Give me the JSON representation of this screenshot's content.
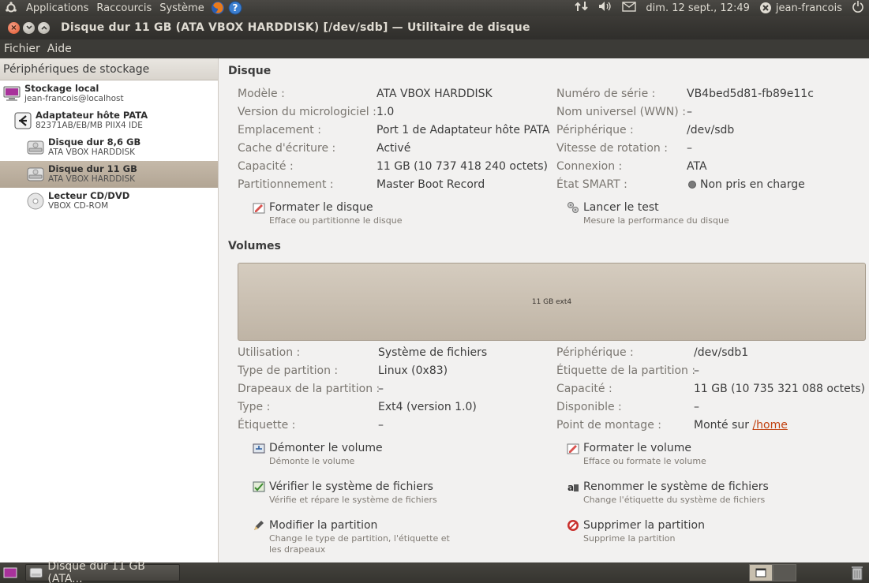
{
  "top_panel": {
    "menus": [
      "Applications",
      "Raccourcis",
      "Système"
    ],
    "clock": "dim. 12 sept., 12:49",
    "user": "jean-francois"
  },
  "window": {
    "title": "Disque dur 11 GB (ATA VBOX HARDDISK) [/dev/sdb] — Utilitaire de disque"
  },
  "menubar": {
    "items": [
      "Fichier",
      "Aide"
    ]
  },
  "sidebar": {
    "header": "Périphériques de stockage",
    "items": [
      {
        "name": "Stockage local",
        "sub": "jean-francois@localhost",
        "icon": "computer-icon"
      },
      {
        "name": "Adaptateur hôte PATA",
        "sub": "82371AB/EB/MB PIIX4 IDE",
        "icon": "adapter-icon"
      },
      {
        "name": "Disque dur 8,6 GB",
        "sub": "ATA VBOX HARDDISK",
        "icon": "harddisk-icon"
      },
      {
        "name": "Disque dur 11 GB",
        "sub": "ATA VBOX HARDDISK",
        "icon": "harddisk-icon",
        "selected": true
      },
      {
        "name": "Lecteur CD/DVD",
        "sub": "VBOX CD-ROM",
        "icon": "cdrom-icon"
      }
    ]
  },
  "disk": {
    "section_title": "Disque",
    "left": [
      {
        "label": "Modèle :",
        "value": "ATA VBOX HARDDISK"
      },
      {
        "label": "Version du micrologiciel :",
        "value": "1.0"
      },
      {
        "label": "Emplacement :",
        "value": "Port 1 de Adaptateur hôte PATA"
      },
      {
        "label": "Cache d'écriture :",
        "value": "Activé"
      },
      {
        "label": "Capacité :",
        "value": "11 GB (10 737 418 240 octets)"
      },
      {
        "label": "Partitionnement :",
        "value": "Master Boot Record"
      }
    ],
    "right": [
      {
        "label": "Numéro de série :",
        "value": "VB4bed5d81-fb89e11c"
      },
      {
        "label": "Nom universel (WWN) :",
        "value": "–"
      },
      {
        "label": "Périphérique :",
        "value": "/dev/sdb"
      },
      {
        "label": "Vitesse de rotation :",
        "value": "–"
      },
      {
        "label": "Connexion :",
        "value": "ATA"
      },
      {
        "label": "État SMART :",
        "value": "Non pris en charge"
      }
    ],
    "actions": [
      {
        "title": "Formater le disque",
        "desc": "Efface ou partitionne le disque"
      },
      {
        "title": "Lancer le test",
        "desc": "Mesure la performance du disque"
      }
    ]
  },
  "volumes": {
    "section_title": "Volumes",
    "bar_label": "11 GB ext4",
    "left": [
      {
        "label": "Utilisation :",
        "value": "Système de fichiers"
      },
      {
        "label": "Type de partition :",
        "value": "Linux (0x83)"
      },
      {
        "label": "Drapeaux de la partition :",
        "value": "–"
      },
      {
        "label": "Type :",
        "value": "Ext4 (version 1.0)"
      },
      {
        "label": "Étiquette :",
        "value": "–"
      }
    ],
    "right": [
      {
        "label": "Périphérique :",
        "value": "/dev/sdb1"
      },
      {
        "label": "Étiquette de la partition :",
        "value": "–"
      },
      {
        "label": "Capacité :",
        "value": "11 GB (10 735 321 088 octets)"
      },
      {
        "label": "Disponible :",
        "value": "–"
      },
      {
        "label": "Point de montage :",
        "value_prefix": "Monté sur ",
        "link": "/home"
      }
    ],
    "actions": [
      {
        "title": "Démonter le volume",
        "desc": "Démonte le volume"
      },
      {
        "title": "Formater le volume",
        "desc": "Efface ou formate le volume"
      },
      {
        "title": "Vérifier le système de fichiers",
        "desc": "Vérifie et répare le système de fichiers"
      },
      {
        "title": "Renommer le système de fichiers",
        "desc": "Change l'étiquette du système de fichiers"
      },
      {
        "title": "Modifier la partition",
        "desc": "Change le type de partition, l'étiquette et",
        "desc2": "les drapeaux"
      },
      {
        "title": "Supprimer la partition",
        "desc": "Supprime la partition"
      }
    ]
  },
  "taskbar": {
    "task_label": "Disque dur 11 GB (ATA..."
  }
}
